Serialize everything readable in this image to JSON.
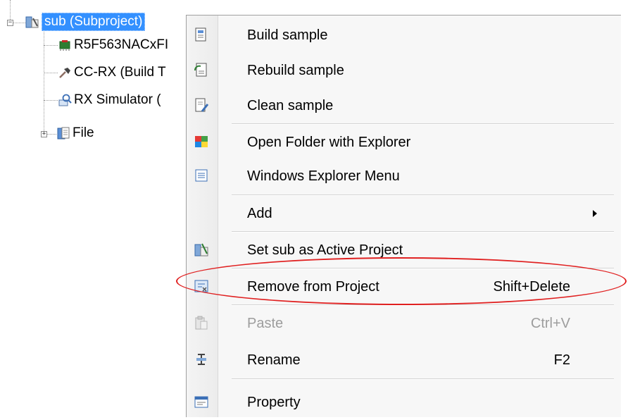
{
  "tree": {
    "root": {
      "label": "sub (Subproject)",
      "icon": "subproject-icon",
      "expander": "minus"
    },
    "children": [
      {
        "label": "R5F563NACxFI",
        "icon": "microcontroller-icon"
      },
      {
        "label": "CC-RX (Build T",
        "icon": "hammer-icon"
      },
      {
        "label": "RX Simulator (",
        "icon": "debug-tool-icon"
      },
      {
        "label": "File",
        "icon": "file-folder-icon",
        "expander": "plus"
      }
    ]
  },
  "menu": {
    "items": [
      {
        "label": "Build sample",
        "icon": "build-icon"
      },
      {
        "label": "Rebuild sample",
        "icon": "rebuild-icon"
      },
      {
        "label": "Clean sample",
        "icon": "clean-icon"
      },
      {
        "label": "Open Folder with Explorer",
        "icon": "explorer-folder-icon"
      },
      {
        "label": "Windows Explorer Menu",
        "icon": "explorer-menu-icon"
      },
      {
        "label": "Add",
        "submenu": true
      },
      {
        "label": "Set sub as Active Project",
        "icon": "active-project-icon"
      },
      {
        "label": "Remove from Project",
        "shortcut": "Shift+Delete",
        "icon": "remove-from-project-icon",
        "highlight_color": "#e02020"
      },
      {
        "label": "Paste",
        "shortcut": "Ctrl+V",
        "icon": "paste-icon",
        "disabled": true
      },
      {
        "label": "Rename",
        "shortcut": "F2",
        "icon": "rename-icon"
      },
      {
        "label": "Property",
        "icon": "property-icon"
      }
    ]
  },
  "colors": {
    "selection": "#3390ff",
    "annotation": "#e02020"
  }
}
